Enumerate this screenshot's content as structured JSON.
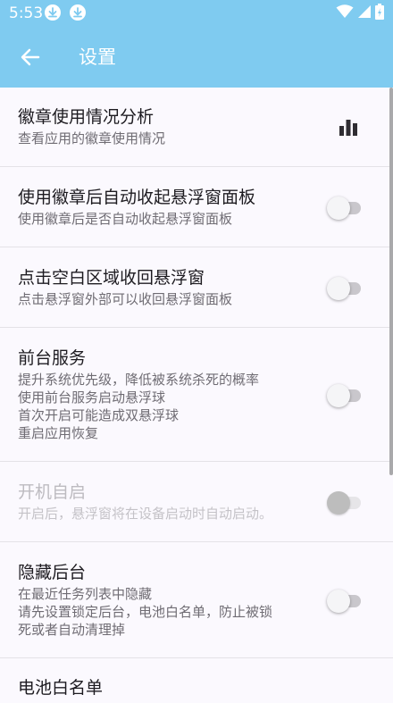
{
  "status_bar": {
    "time": "5:53",
    "notification_icons": [
      "download-icon",
      "download-icon"
    ],
    "right_icons": [
      "wifi-icon",
      "signal-icon",
      "battery-charging-icon"
    ]
  },
  "toolbar": {
    "back_icon": "arrow-left-icon",
    "title": "设置"
  },
  "colors": {
    "header": "#7fcbf0",
    "background": "#fbf9fe",
    "divider": "#e4e2e7"
  },
  "settings": [
    {
      "title": "徽章使用情况分析",
      "subtitle": "查看应用的徽章使用情况",
      "control": "bar-chart-icon",
      "enabled": true
    },
    {
      "title": "使用徽章后自动收起悬浮窗面板",
      "subtitle": "使用徽章后是否自动收起悬浮窗面板",
      "control": "toggle",
      "checked": false,
      "enabled": true
    },
    {
      "title": "点击空白区域收回悬浮窗",
      "subtitle": "点击悬浮窗外部可以收回悬浮窗面板",
      "control": "toggle",
      "checked": false,
      "enabled": true
    },
    {
      "title": "前台服务",
      "subtitle_lines": [
        "提升系统优先级，降低被系统杀死的概率",
        "使用前台服务启动悬浮球",
        "首次开启可能造成双悬浮球",
        "重启应用恢复"
      ],
      "control": "toggle",
      "checked": false,
      "enabled": true
    },
    {
      "title": "开机自启",
      "subtitle": "开启后，悬浮窗将在设备启动时自动启动。",
      "control": "toggle",
      "checked": false,
      "enabled": false
    },
    {
      "title": "隐藏后台",
      "subtitle_lines": [
        "在最近任务列表中隐藏",
        "请先设置锁定后台，电池白名单，防止被锁",
        "死或者自动清理掉"
      ],
      "control": "toggle",
      "checked": false,
      "enabled": true
    },
    {
      "title": "电池白名单"
    }
  ]
}
